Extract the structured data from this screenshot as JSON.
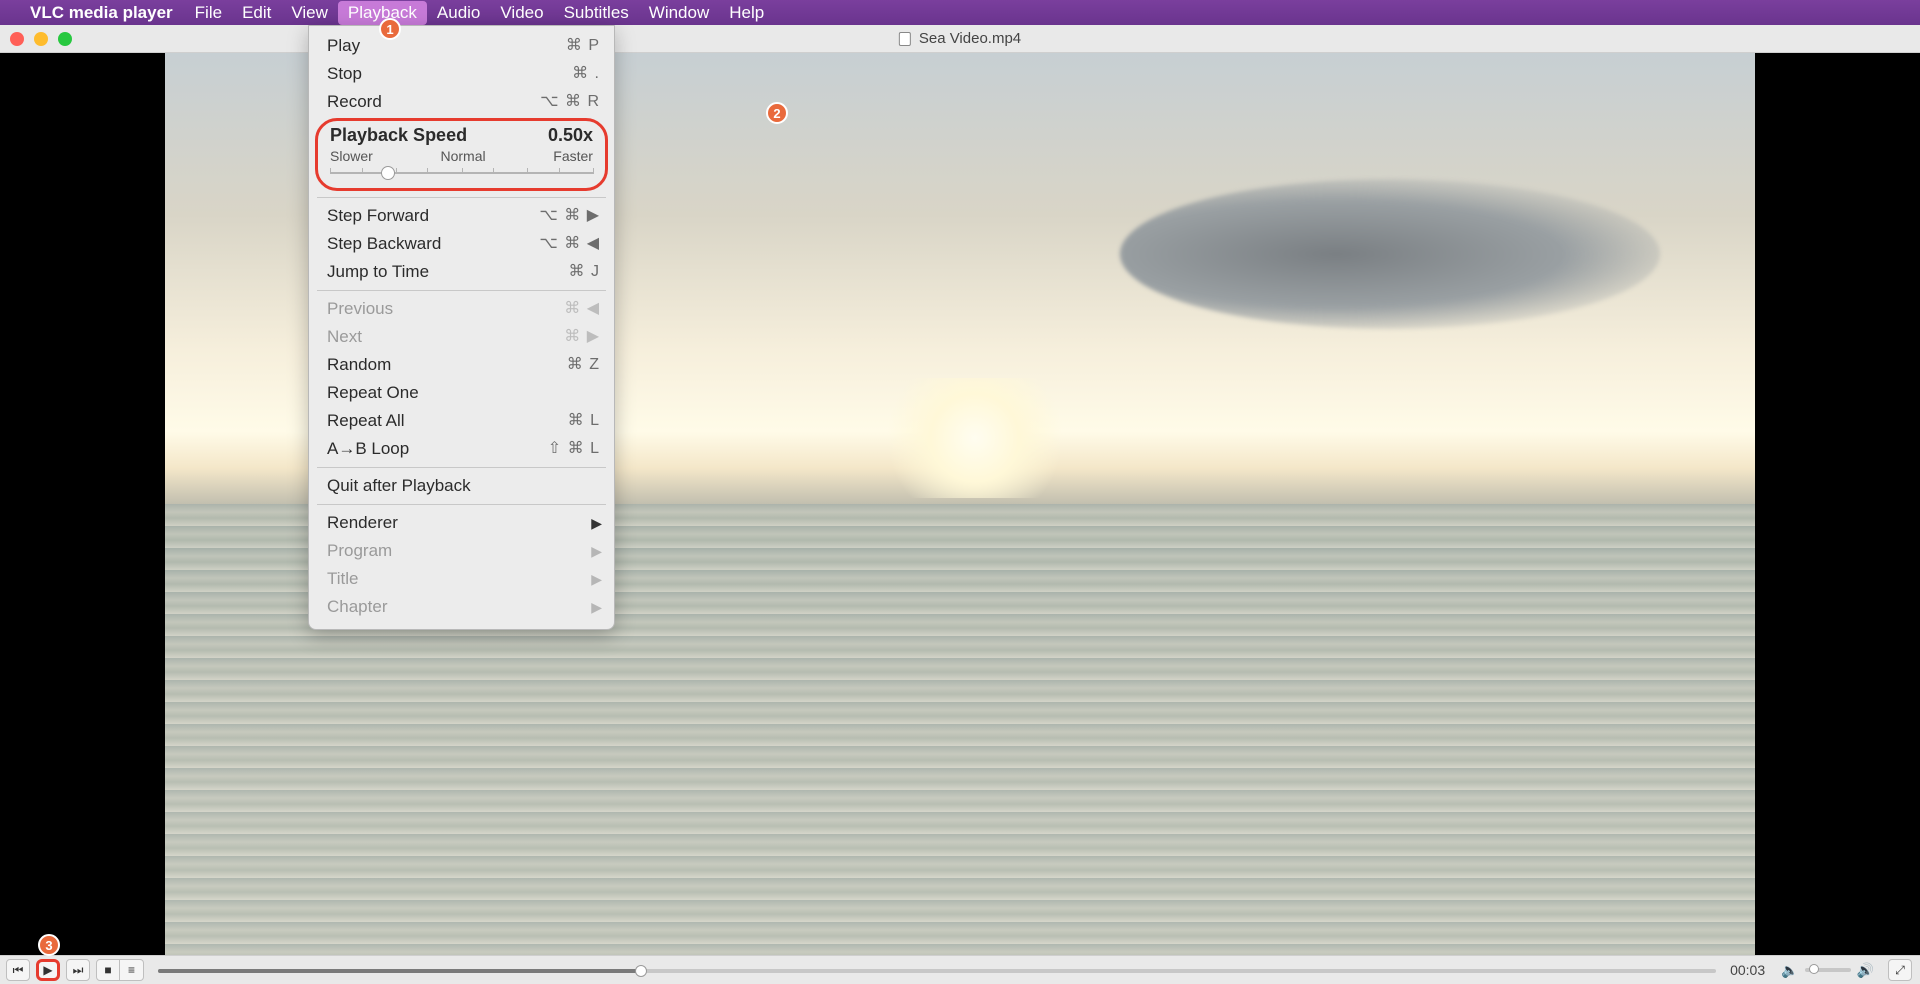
{
  "menubar": {
    "app_name": "VLC media player",
    "items": [
      {
        "label": "File"
      },
      {
        "label": "Edit"
      },
      {
        "label": "View"
      },
      {
        "label": "Playback",
        "selected": true
      },
      {
        "label": "Audio"
      },
      {
        "label": "Video"
      },
      {
        "label": "Subtitles"
      },
      {
        "label": "Window"
      },
      {
        "label": "Help"
      }
    ]
  },
  "titlebar": {
    "document_title": "Sea Video.mp4"
  },
  "dropdown": {
    "play": {
      "label": "Play",
      "shortcut": "⌘ P"
    },
    "stop": {
      "label": "Stop",
      "shortcut": "⌘ ."
    },
    "record": {
      "label": "Record",
      "shortcut": "⌥ ⌘ R"
    },
    "speed": {
      "header": "Playback Speed",
      "value": "0.50x",
      "min_label": "Slower",
      "mid_label": "Normal",
      "max_label": "Faster",
      "thumb_pct": 22
    },
    "step_fwd": {
      "label": "Step Forward",
      "shortcut": "⌥ ⌘ ▶"
    },
    "step_bwd": {
      "label": "Step Backward",
      "shortcut": "⌥ ⌘ ◀"
    },
    "jump": {
      "label": "Jump to Time",
      "shortcut": "⌘ J"
    },
    "previous": {
      "label": "Previous",
      "shortcut": "⌘ ◀",
      "disabled": true
    },
    "next": {
      "label": "Next",
      "shortcut": "⌘ ▶",
      "disabled": true
    },
    "random": {
      "label": "Random",
      "shortcut": "⌘ Z"
    },
    "repeat_one": {
      "label": "Repeat One"
    },
    "repeat_all": {
      "label": "Repeat All",
      "shortcut": "⌘ L"
    },
    "ab_loop": {
      "label": "A→B Loop",
      "shortcut": "⇧ ⌘ L"
    },
    "quit_after": {
      "label": "Quit after Playback"
    },
    "renderer": {
      "label": "Renderer"
    },
    "program": {
      "label": "Program",
      "disabled": true
    },
    "title_m": {
      "label": "Title",
      "disabled": true
    },
    "chapter": {
      "label": "Chapter",
      "disabled": true
    }
  },
  "controls": {
    "time": "00:03",
    "progress_pct": 31,
    "volume_pct": 20
  },
  "callouts": {
    "one": "1",
    "two": "2",
    "three": "3"
  },
  "colors": {
    "accent_red": "#e63b2e",
    "callout_orange": "#e96a3c",
    "menubar_purple": "#6a348e"
  }
}
